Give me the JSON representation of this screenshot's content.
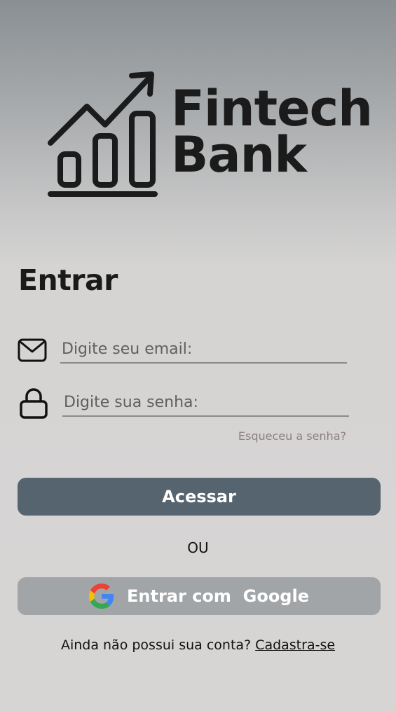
{
  "brand": {
    "line1": "Fintech",
    "line2": "Bank"
  },
  "login": {
    "title": "Entrar",
    "email_placeholder": "Digite seu email:",
    "password_placeholder": "Digite sua senha:",
    "forgot_label": "Esqueceu a senha?",
    "submit_label": "Acessar",
    "divider_label": "OU",
    "google_label": "Entrar com  Google"
  },
  "signup": {
    "prompt": "Ainda não possui sua conta?",
    "link_label": "Cadastra-se"
  },
  "icons": {
    "email": "envelope-icon",
    "password": "lock-icon",
    "google": "google-g-icon"
  },
  "colors": {
    "primary_button": "#56646f",
    "google_button": "#a2a5a8",
    "forgot_link": "#8b7f7f"
  }
}
